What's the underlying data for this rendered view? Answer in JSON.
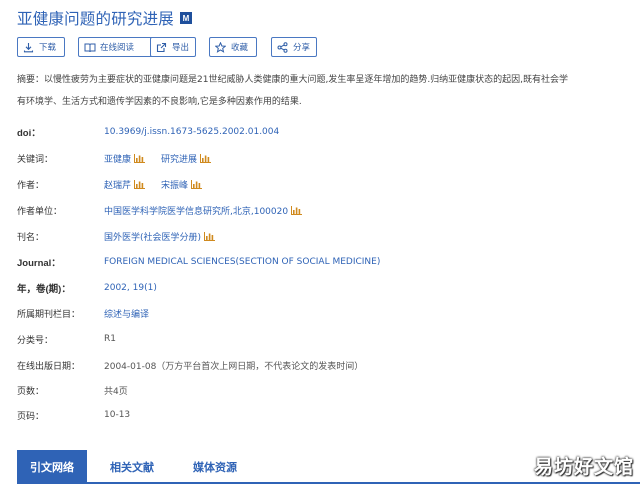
{
  "article": {
    "title": "亚健康问题的研究进展",
    "badge": "M"
  },
  "toolbar": {
    "download": "下载",
    "read_online": "在线阅读",
    "export": "导出",
    "favorite": "收藏",
    "share": "分享"
  },
  "abstract": {
    "line1": "摘要：以慢性疲劳为主要症状的亚健康问题是21世纪威胁人类健康的重大问题,发生率呈逐年增加的趋势.归纳亚健康状态的起因,既有社会学",
    "line2": "有环境学、生活方式和遗传学因素的不良影响,它是多种因素作用的结果."
  },
  "fields": {
    "doi_label": "doi：",
    "doi_value": "10.3969/j.issn.1673-5625.2002.01.004",
    "keywords_label": "关键词：",
    "keywords": [
      "亚健康",
      "研究进展"
    ],
    "authors_label": "作者：",
    "authors": [
      "赵瑞芹",
      "宋振峰"
    ],
    "affiliation_label": "作者单位：",
    "affiliation_value": "中国医学科学院医学信息研究所,北京,100020",
    "journal_cn_label": "刊名：",
    "journal_cn_value": "国外医学(社会医学分册)",
    "journal_label": "Journal：",
    "journal_value": "FOREIGN MEDICAL SCIENCES(SECTION OF SOCIAL MEDICINE)",
    "year_label": "年，卷(期)：",
    "year_value": "2002, 19(1)",
    "column_label": "所属期刊栏目：",
    "column_value": "综述与编译",
    "class_label": "分类号：",
    "class_value": "R1",
    "online_label": "在线出版日期：",
    "online_value": "2004-01-08（万方平台首次上网日期，不代表论文的发表时间）",
    "pages_label": "页数：",
    "pages_value": "共4页",
    "pagenum_label": "页码：",
    "pagenum_value": "10-13"
  },
  "tabs": [
    "引文网络",
    "相关文献",
    "媒体资源"
  ],
  "watermark": "易坊好文馆",
  "colors": {
    "accent": "#2f63b6",
    "chart_icon": "#d08a1e"
  }
}
